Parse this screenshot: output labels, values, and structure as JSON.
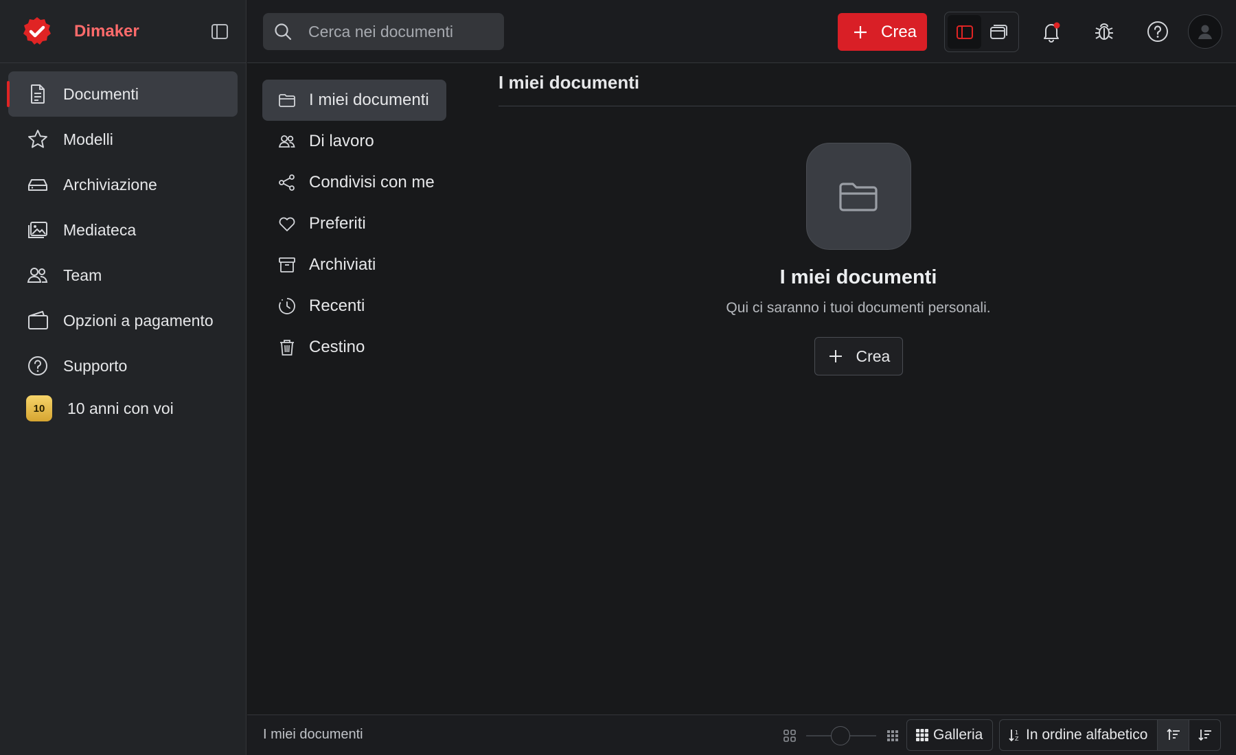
{
  "app": {
    "name": "Dimaker",
    "brand_color": "#e02424"
  },
  "sidebar": {
    "items": [
      {
        "label": "Documenti",
        "icon": "document-icon",
        "active": true
      },
      {
        "label": "Modelli",
        "icon": "star-icon"
      },
      {
        "label": "Archiviazione",
        "icon": "storage-drive-icon"
      },
      {
        "label": "Mediateca",
        "icon": "image-library-icon"
      },
      {
        "label": "Team",
        "icon": "team-icon"
      },
      {
        "label": "Opzioni a pagamento",
        "icon": "wallet-icon"
      },
      {
        "label": "Supporto",
        "icon": "help-circle-icon"
      },
      {
        "label": "10 anni con voi",
        "badge": "10"
      }
    ]
  },
  "topbar": {
    "search_placeholder": "Cerca nei documenti",
    "create_label": "Crea"
  },
  "doc_nav": {
    "items": [
      {
        "label": "I miei documenti",
        "icon": "folder-icon",
        "active": true
      },
      {
        "label": "Di lavoro",
        "icon": "users-icon"
      },
      {
        "label": "Condivisi con me",
        "icon": "share-icon"
      },
      {
        "label": "Preferiti",
        "icon": "heart-icon"
      },
      {
        "label": "Archiviati",
        "icon": "archive-box-icon"
      },
      {
        "label": "Recenti",
        "icon": "clock-icon"
      },
      {
        "label": "Cestino",
        "icon": "trash-icon"
      }
    ]
  },
  "main": {
    "title": "I miei documenti",
    "empty_state": {
      "title": "I miei documenti",
      "description": "Qui ci saranno i tuoi documenti personali.",
      "create_label": "Crea"
    }
  },
  "footer": {
    "path": "I miei documenti",
    "view_mode": "Galleria",
    "sort": "In ordine alfabetico"
  }
}
